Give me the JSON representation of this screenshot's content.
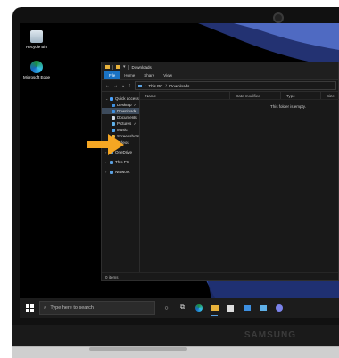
{
  "device": {
    "brand": "SAMSUNG"
  },
  "desktop": {
    "icons": [
      {
        "label": "Recycle Bin",
        "icon": "recycle-bin-icon"
      },
      {
        "label": "Microsoft Edge",
        "icon": "edge-icon"
      }
    ]
  },
  "explorer": {
    "title": "Downloads",
    "ribbon_tabs": [
      "File",
      "Home",
      "Share",
      "View"
    ],
    "breadcrumb": [
      "This PC",
      "Downloads"
    ],
    "nav": {
      "quick_access": "Quick access",
      "items": [
        {
          "label": "Desktop",
          "pinned": "✓"
        },
        {
          "label": "Downloads",
          "pinned": "✓"
        },
        {
          "label": "Documents",
          "pinned": "✓"
        },
        {
          "label": "Pictures",
          "pinned": "✓"
        },
        {
          "label": "Music"
        },
        {
          "label": "Screenshots"
        },
        {
          "label": "Videos"
        }
      ],
      "onedrive": "OneDrive",
      "this_pc": "This PC",
      "network": "Network"
    },
    "columns": [
      "Name",
      "Date modified",
      "Type",
      "Size"
    ],
    "empty_message": "This folder is empty.",
    "status": "0 items"
  },
  "taskbar": {
    "search_placeholder": "Type here to search",
    "icons": [
      "task-view-icon",
      "edge-icon",
      "file-explorer-icon",
      "store-icon",
      "mail-icon",
      "photos-icon",
      "teams-icon"
    ]
  },
  "colors": {
    "accent": "#1a73c4",
    "arrow": "#f5a623",
    "selection": "#3d4b5c"
  }
}
